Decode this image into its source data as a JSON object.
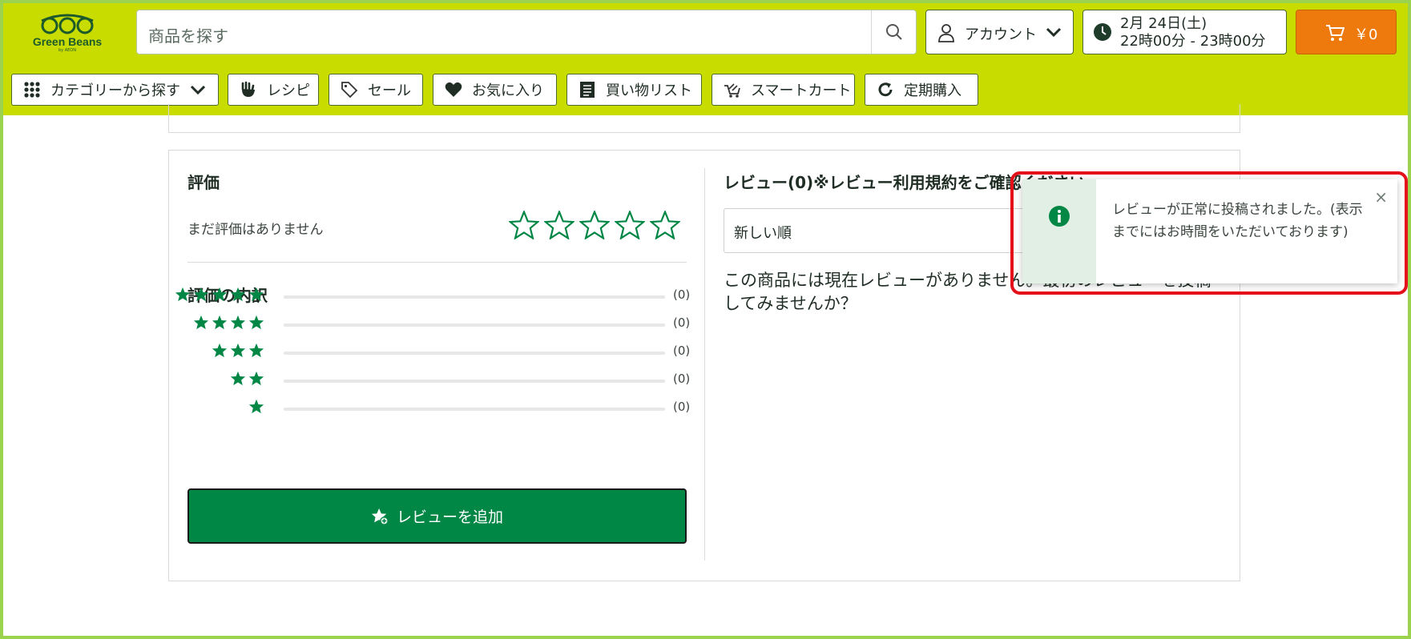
{
  "header": {
    "logo_text": "Green Beans",
    "logo_sub": "by AEON",
    "search_placeholder": "商品を探す",
    "account_label": "アカウント",
    "delivery_date": "2月 24日(土)",
    "delivery_time": "22時00分 - 23時00分",
    "cart_total": "￥0"
  },
  "nav": {
    "categories": "カテゴリーから探す",
    "recipes": "レシピ",
    "sale": "セール",
    "favorites": "お気に入り",
    "shopping_list": "買い物リスト",
    "smart_cart": "スマートカート",
    "subscription": "定期購入"
  },
  "rating": {
    "title": "評価",
    "no_rating": "まだ評価はありません",
    "breakdown_title": "評価の内訳",
    "breakdown": [
      {
        "stars": 5,
        "count": 0,
        "label": "(0)"
      },
      {
        "stars": 4,
        "count": 0,
        "label": "(0)"
      },
      {
        "stars": 3,
        "count": 0,
        "label": "(0)"
      },
      {
        "stars": 2,
        "count": 0,
        "label": "(0)"
      },
      {
        "stars": 1,
        "count": 0,
        "label": "(0)"
      }
    ],
    "add_review": "レビューを追加"
  },
  "reviews": {
    "title": "レビュー(0)※レビュー利用規約をご確認ください",
    "sort_value": "新しい順",
    "empty_message": "この商品には現在レビューがありません。最初のレビューを投稿してみませんか？"
  },
  "toast": {
    "message": "レビューが正常に投稿されました。(表示までにはお時間をいただいております)",
    "close": "×"
  },
  "colors": {
    "header_bg": "#c8dc00",
    "brand_green": "#008746",
    "cart_orange": "#ee7a0e",
    "highlight_red": "#e4101b"
  }
}
